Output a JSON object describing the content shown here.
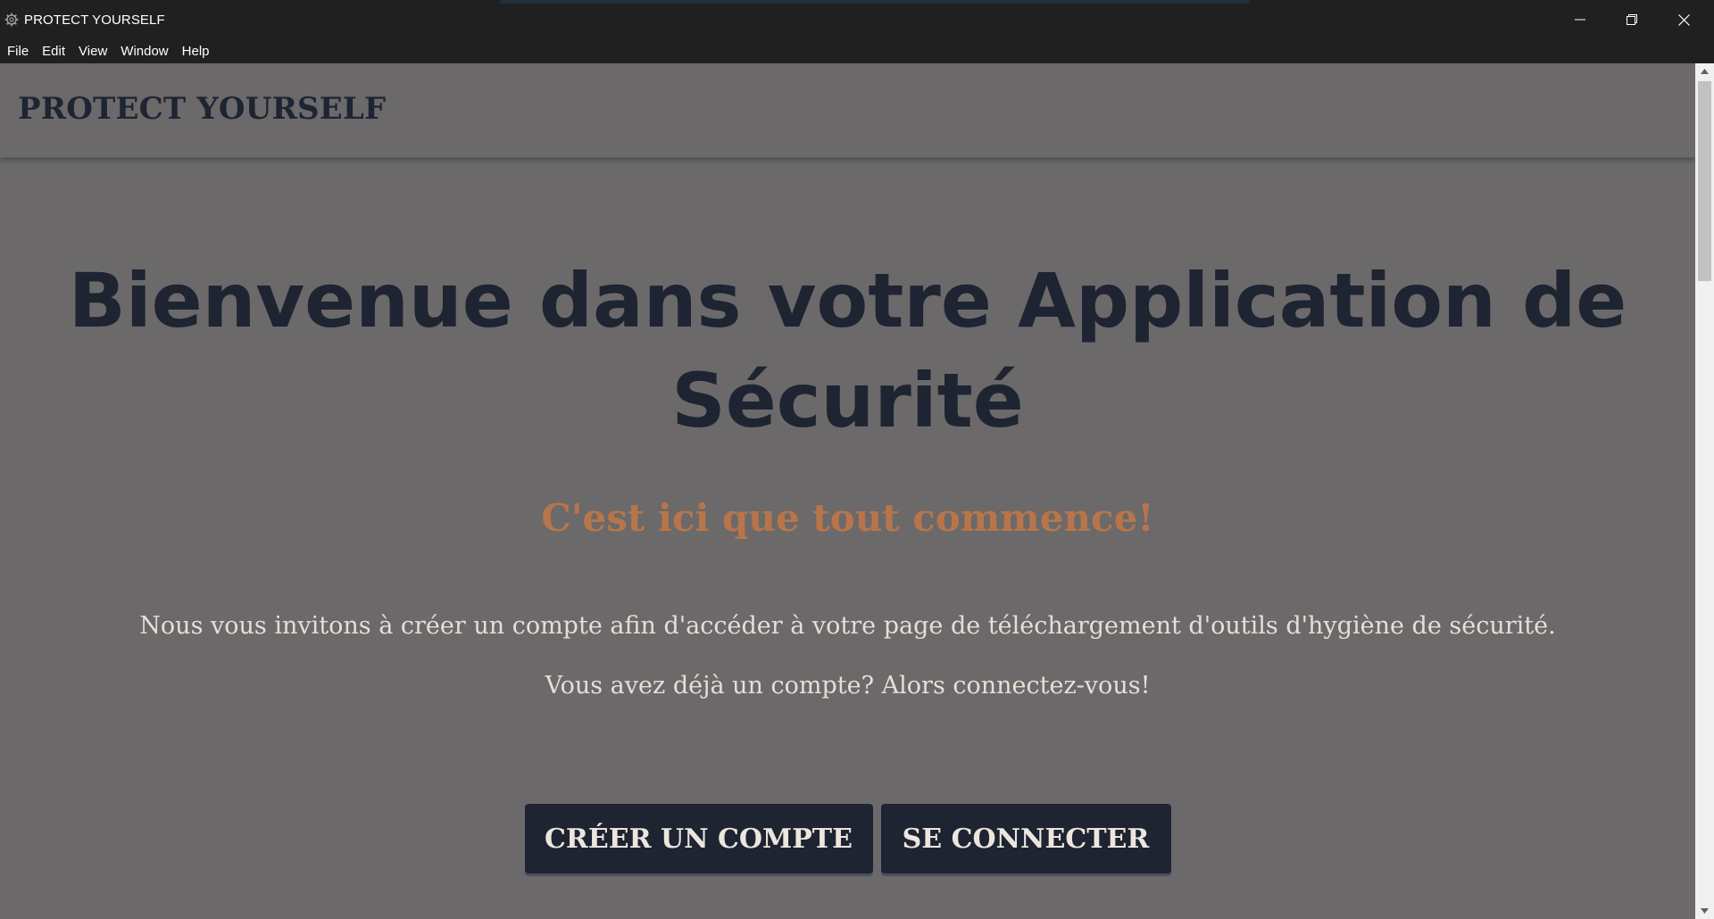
{
  "window": {
    "title": "PROTECT YOURSELF",
    "icon": "gear-icon",
    "controls": {
      "minimize": "minimize-icon",
      "maximize": "restore-icon",
      "close": "close-icon"
    }
  },
  "menubar": {
    "items": [
      "File",
      "Edit",
      "View",
      "Window",
      "Help"
    ]
  },
  "header": {
    "brand": "PROTECT YOURSELF"
  },
  "hero": {
    "title_line1": "Bienvenue dans votre Application de",
    "title_line2": "Sécurité",
    "subtitle": "C'est ici que tout commence!",
    "intro": "Nous vous invitons à créer un compte afin d'accéder à votre page de téléchargement d'outils d'hygiène de sécurité.",
    "login_prompt": "Vous avez déjà un compte? Alors connectez-vous!"
  },
  "actions": {
    "create_account": "CRÉER UN COMPTE",
    "login": "SE CONNECTER"
  },
  "colors": {
    "background": "#6b696a",
    "heading": "#1e2431",
    "accent": "#b8754a",
    "body_text": "#e6dfd6",
    "button_bg": "#1e2431",
    "chrome": "#202020"
  }
}
